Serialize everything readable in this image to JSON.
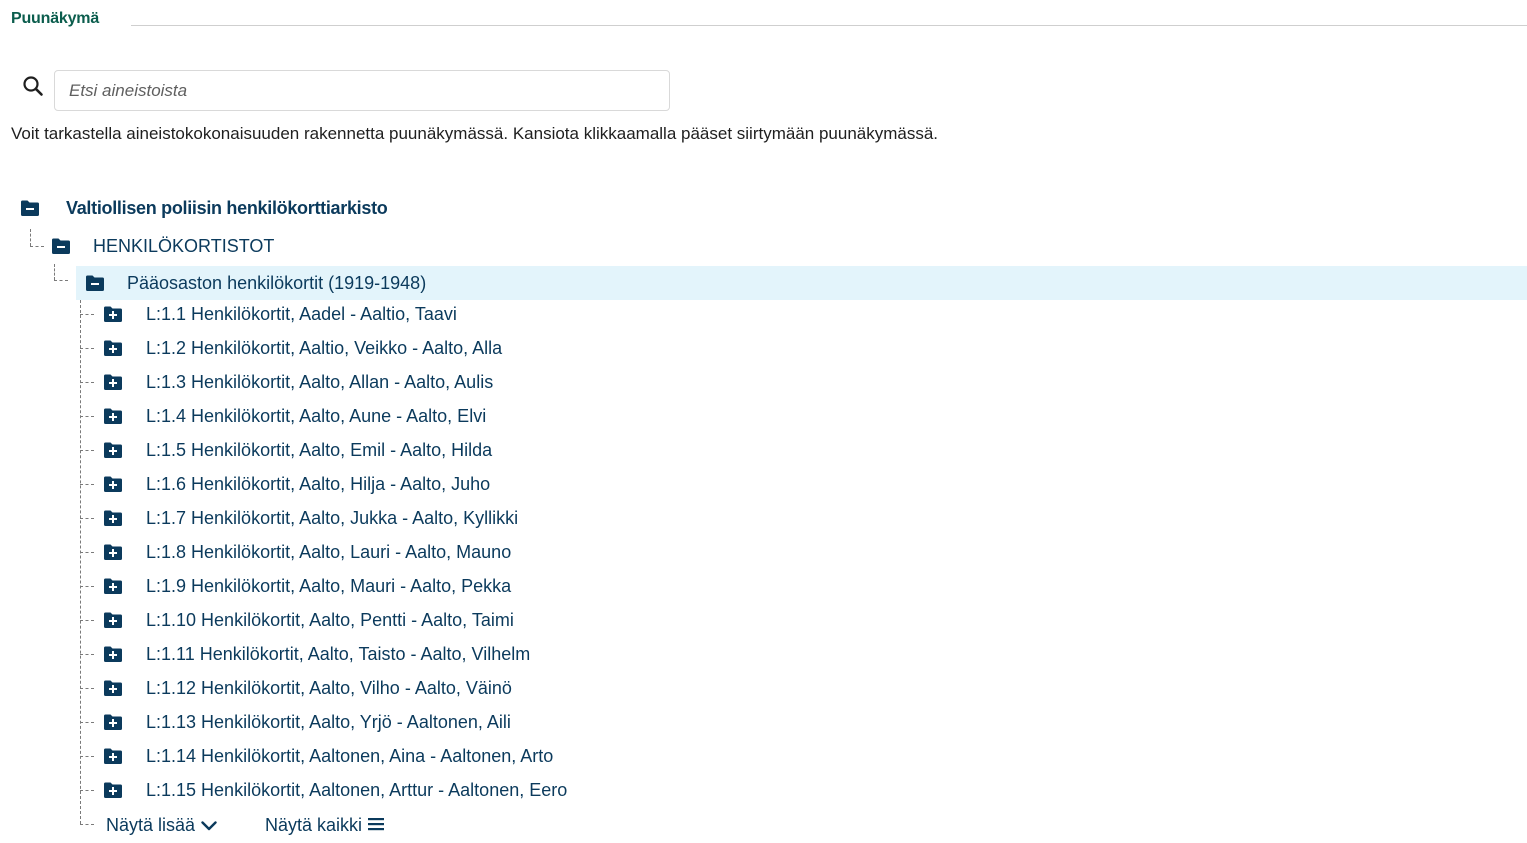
{
  "section": {
    "title": "Puunäkymä"
  },
  "search": {
    "placeholder": "Etsi aineistoista",
    "value": ""
  },
  "description": "Voit tarkastella aineistokokonaisuuden rakennetta puunäkymässä. Kansiota klikkaamalla pääset siirtymään puunäkymässä.",
  "tree": {
    "root": {
      "label": "Valtiollisen poliisin henkilökorttiarkisto",
      "icon": "folder-minus-icon"
    },
    "level1": {
      "label": "HENKILÖKORTISTOT",
      "icon": "folder-minus-icon"
    },
    "level2": {
      "label": "Pääosaston henkilökortit (1919-1948)",
      "icon": "folder-minus-icon",
      "selected": true
    },
    "children": [
      {
        "label": "L:1.1 Henkilökortit, Aadel - Aaltio, Taavi",
        "icon": "folder-plus-icon"
      },
      {
        "label": "L:1.2 Henkilökortit, Aaltio, Veikko - Aalto, Alla",
        "icon": "folder-plus-icon"
      },
      {
        "label": "L:1.3 Henkilökortit, Aalto, Allan - Aalto, Aulis",
        "icon": "folder-plus-icon"
      },
      {
        "label": "L:1.4 Henkilökortit, Aalto, Aune - Aalto, Elvi",
        "icon": "folder-plus-icon"
      },
      {
        "label": "L:1.5 Henkilökortit, Aalto, Emil - Aalto, Hilda",
        "icon": "folder-plus-icon"
      },
      {
        "label": "L:1.6 Henkilökortit, Aalto, Hilja - Aalto, Juho",
        "icon": "folder-plus-icon"
      },
      {
        "label": "L:1.7 Henkilökortit, Aalto, Jukka - Aalto, Kyllikki",
        "icon": "folder-plus-icon"
      },
      {
        "label": "L:1.8 Henkilökortit, Aalto, Lauri - Aalto, Mauno",
        "icon": "folder-plus-icon"
      },
      {
        "label": "L:1.9 Henkilökortit, Aalto, Mauri - Aalto, Pekka",
        "icon": "folder-plus-icon"
      },
      {
        "label": "L:1.10 Henkilökortit, Aalto, Pentti - Aalto, Taimi",
        "icon": "folder-plus-icon"
      },
      {
        "label": "L:1.11 Henkilökortit, Aalto, Taisto - Aalto, Vilhelm",
        "icon": "folder-plus-icon"
      },
      {
        "label": "L:1.12 Henkilökortit, Aalto, Vilho - Aalto, Väinö",
        "icon": "folder-plus-icon"
      },
      {
        "label": "L:1.13 Henkilökortit, Aalto, Yrjö - Aaltonen, Aili",
        "icon": "folder-plus-icon"
      },
      {
        "label": "L:1.14 Henkilökortit, Aaltonen, Aina - Aaltonen, Arto",
        "icon": "folder-plus-icon"
      },
      {
        "label": "L:1.15 Henkilökortit, Aaltonen, Arttur - Aaltonen, Eero",
        "icon": "folder-plus-icon"
      }
    ],
    "show_more_label": "Näytä lisää",
    "show_all_label": "Näytä kaikki"
  },
  "colors": {
    "title": "#0b5d4d",
    "link": "#0b3a5c",
    "icon": "#0b3a5c",
    "selected_bg": "#e3f4fb"
  }
}
